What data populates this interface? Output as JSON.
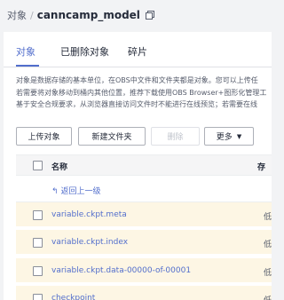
{
  "breadcrumb": {
    "parent": "对象",
    "separator": "/",
    "current": "canncamp_model"
  },
  "tabs": [
    {
      "label": "对象",
      "active": true
    },
    {
      "label": "已删除对象",
      "active": false
    },
    {
      "label": "碎片",
      "active": false
    }
  ],
  "info_lines": [
    "对象是数据存储的基本单位，在OBS中文件和文件夹都是对象。您可以上传任",
    "若需要将对象移动到桶内其他位置，推荐下载使用OBS Browser+图形化管理工",
    "基于安全合规要求，从浏览器直接访问文件时不能进行在线预览；若需要在线"
  ],
  "toolbar": {
    "upload_label": "上传对象",
    "new_folder_label": "新建文件夹",
    "delete_label": "删除",
    "more_label": "更多"
  },
  "table": {
    "col_name": "名称",
    "col_storage": "存",
    "back_label": "返回上一级",
    "rows": [
      {
        "name": "variable.ckpt.meta",
        "storage": "低"
      },
      {
        "name": "variable.ckpt.index",
        "storage": "低"
      },
      {
        "name": "variable.ckpt.data-00000-of-00001",
        "storage": "低"
      },
      {
        "name": "checkpoint",
        "storage": "低"
      }
    ]
  },
  "colors": {
    "accent": "#526ecc",
    "row_highlight": "#fdf6e4",
    "page_bg": "#f2f3f5"
  }
}
